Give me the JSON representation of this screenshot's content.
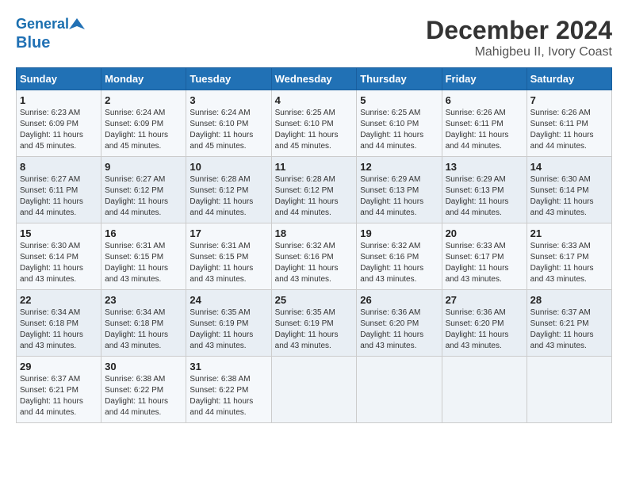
{
  "logo": {
    "line1": "General",
    "line2": "Blue"
  },
  "header": {
    "month": "December 2024",
    "location": "Mahigbeu II, Ivory Coast"
  },
  "weekdays": [
    "Sunday",
    "Monday",
    "Tuesday",
    "Wednesday",
    "Thursday",
    "Friday",
    "Saturday"
  ],
  "weeks": [
    [
      {
        "day": "1",
        "sunrise": "6:23 AM",
        "sunset": "6:09 PM",
        "daylight": "11 hours and 45 minutes."
      },
      {
        "day": "2",
        "sunrise": "6:24 AM",
        "sunset": "6:09 PM",
        "daylight": "11 hours and 45 minutes."
      },
      {
        "day": "3",
        "sunrise": "6:24 AM",
        "sunset": "6:10 PM",
        "daylight": "11 hours and 45 minutes."
      },
      {
        "day": "4",
        "sunrise": "6:25 AM",
        "sunset": "6:10 PM",
        "daylight": "11 hours and 45 minutes."
      },
      {
        "day": "5",
        "sunrise": "6:25 AM",
        "sunset": "6:10 PM",
        "daylight": "11 hours and 44 minutes."
      },
      {
        "day": "6",
        "sunrise": "6:26 AM",
        "sunset": "6:11 PM",
        "daylight": "11 hours and 44 minutes."
      },
      {
        "day": "7",
        "sunrise": "6:26 AM",
        "sunset": "6:11 PM",
        "daylight": "11 hours and 44 minutes."
      }
    ],
    [
      {
        "day": "8",
        "sunrise": "6:27 AM",
        "sunset": "6:11 PM",
        "daylight": "11 hours and 44 minutes."
      },
      {
        "day": "9",
        "sunrise": "6:27 AM",
        "sunset": "6:12 PM",
        "daylight": "11 hours and 44 minutes."
      },
      {
        "day": "10",
        "sunrise": "6:28 AM",
        "sunset": "6:12 PM",
        "daylight": "11 hours and 44 minutes."
      },
      {
        "day": "11",
        "sunrise": "6:28 AM",
        "sunset": "6:12 PM",
        "daylight": "11 hours and 44 minutes."
      },
      {
        "day": "12",
        "sunrise": "6:29 AM",
        "sunset": "6:13 PM",
        "daylight": "11 hours and 44 minutes."
      },
      {
        "day": "13",
        "sunrise": "6:29 AM",
        "sunset": "6:13 PM",
        "daylight": "11 hours and 44 minutes."
      },
      {
        "day": "14",
        "sunrise": "6:30 AM",
        "sunset": "6:14 PM",
        "daylight": "11 hours and 43 minutes."
      }
    ],
    [
      {
        "day": "15",
        "sunrise": "6:30 AM",
        "sunset": "6:14 PM",
        "daylight": "11 hours and 43 minutes."
      },
      {
        "day": "16",
        "sunrise": "6:31 AM",
        "sunset": "6:15 PM",
        "daylight": "11 hours and 43 minutes."
      },
      {
        "day": "17",
        "sunrise": "6:31 AM",
        "sunset": "6:15 PM",
        "daylight": "11 hours and 43 minutes."
      },
      {
        "day": "18",
        "sunrise": "6:32 AM",
        "sunset": "6:16 PM",
        "daylight": "11 hours and 43 minutes."
      },
      {
        "day": "19",
        "sunrise": "6:32 AM",
        "sunset": "6:16 PM",
        "daylight": "11 hours and 43 minutes."
      },
      {
        "day": "20",
        "sunrise": "6:33 AM",
        "sunset": "6:17 PM",
        "daylight": "11 hours and 43 minutes."
      },
      {
        "day": "21",
        "sunrise": "6:33 AM",
        "sunset": "6:17 PM",
        "daylight": "11 hours and 43 minutes."
      }
    ],
    [
      {
        "day": "22",
        "sunrise": "6:34 AM",
        "sunset": "6:18 PM",
        "daylight": "11 hours and 43 minutes."
      },
      {
        "day": "23",
        "sunrise": "6:34 AM",
        "sunset": "6:18 PM",
        "daylight": "11 hours and 43 minutes."
      },
      {
        "day": "24",
        "sunrise": "6:35 AM",
        "sunset": "6:19 PM",
        "daylight": "11 hours and 43 minutes."
      },
      {
        "day": "25",
        "sunrise": "6:35 AM",
        "sunset": "6:19 PM",
        "daylight": "11 hours and 43 minutes."
      },
      {
        "day": "26",
        "sunrise": "6:36 AM",
        "sunset": "6:20 PM",
        "daylight": "11 hours and 43 minutes."
      },
      {
        "day": "27",
        "sunrise": "6:36 AM",
        "sunset": "6:20 PM",
        "daylight": "11 hours and 43 minutes."
      },
      {
        "day": "28",
        "sunrise": "6:37 AM",
        "sunset": "6:21 PM",
        "daylight": "11 hours and 43 minutes."
      }
    ],
    [
      {
        "day": "29",
        "sunrise": "6:37 AM",
        "sunset": "6:21 PM",
        "daylight": "11 hours and 44 minutes."
      },
      {
        "day": "30",
        "sunrise": "6:38 AM",
        "sunset": "6:22 PM",
        "daylight": "11 hours and 44 minutes."
      },
      {
        "day": "31",
        "sunrise": "6:38 AM",
        "sunset": "6:22 PM",
        "daylight": "11 hours and 44 minutes."
      },
      null,
      null,
      null,
      null
    ]
  ]
}
